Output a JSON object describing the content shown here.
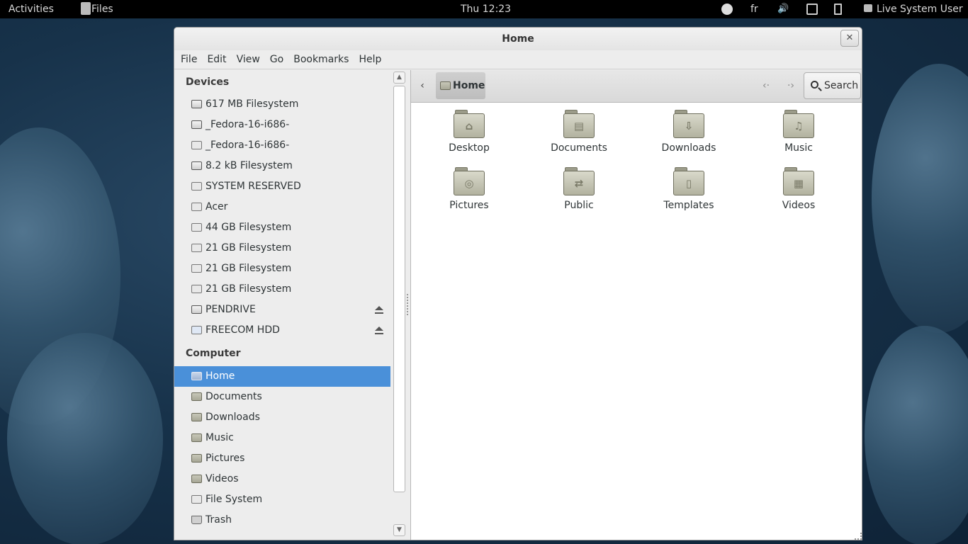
{
  "topbar": {
    "activities": "Activities",
    "app_name": "Files",
    "clock": "Thu 12:23",
    "keyboard_layout": "fr",
    "user": "Live System User"
  },
  "window": {
    "title": "Home",
    "close_glyph": "✕"
  },
  "menubar": {
    "items": [
      "File",
      "Edit",
      "View",
      "Go",
      "Bookmarks",
      "Help"
    ]
  },
  "sidebar": {
    "devices_heading": "Devices",
    "devices": [
      {
        "label": "617 MB Filesystem",
        "icon": "drive-icon"
      },
      {
        "label": "_Fedora-16-i686-",
        "icon": "drive-icon"
      },
      {
        "label": "_Fedora-16-i686-",
        "icon": "disk-icon"
      },
      {
        "label": "8.2 kB Filesystem",
        "icon": "drive-icon"
      },
      {
        "label": "SYSTEM RESERVED",
        "icon": "disk-icon"
      },
      {
        "label": "Acer",
        "icon": "disk-icon"
      },
      {
        "label": "44 GB Filesystem",
        "icon": "disk-icon"
      },
      {
        "label": "21 GB Filesystem",
        "icon": "disk-icon"
      },
      {
        "label": "21 GB Filesystem",
        "icon": "disk-icon"
      },
      {
        "label": "21 GB Filesystem",
        "icon": "disk-icon"
      },
      {
        "label": "PENDRIVE",
        "icon": "drive-icon",
        "eject": true
      },
      {
        "label": "FREECOM HDD",
        "icon": "usb-disk-icon",
        "eject": true
      }
    ],
    "computer_heading": "Computer",
    "computer": [
      {
        "label": "Home",
        "icon": "home-folder-icon",
        "selected": true
      },
      {
        "label": "Documents",
        "icon": "documents-folder-icon"
      },
      {
        "label": "Downloads",
        "icon": "downloads-folder-icon"
      },
      {
        "label": "Music",
        "icon": "music-folder-icon"
      },
      {
        "label": "Pictures",
        "icon": "pictures-folder-icon"
      },
      {
        "label": "Videos",
        "icon": "videos-folder-icon"
      },
      {
        "label": "File System",
        "icon": "filesystem-icon"
      },
      {
        "label": "Trash",
        "icon": "trash-icon"
      }
    ]
  },
  "pathbar": {
    "back_glyph": "‹",
    "current": "Home",
    "nav_back_glyph": "‹·",
    "nav_forward_glyph": "·›",
    "search_label": "Search"
  },
  "files": [
    {
      "label": "Desktop",
      "icon": "desktop-folder-icon",
      "emblem": "⌂"
    },
    {
      "label": "Documents",
      "icon": "documents-folder-icon",
      "emblem": "▤"
    },
    {
      "label": "Downloads",
      "icon": "downloads-folder-icon",
      "emblem": "⇩"
    },
    {
      "label": "Music",
      "icon": "music-folder-icon",
      "emblem": "♫"
    },
    {
      "label": "Pictures",
      "icon": "pictures-folder-icon",
      "emblem": "◎"
    },
    {
      "label": "Public",
      "icon": "public-folder-icon",
      "emblem": "⇄"
    },
    {
      "label": "Templates",
      "icon": "templates-folder-icon",
      "emblem": "▯"
    },
    {
      "label": "Videos",
      "icon": "videos-folder-icon",
      "emblem": "▦"
    }
  ]
}
